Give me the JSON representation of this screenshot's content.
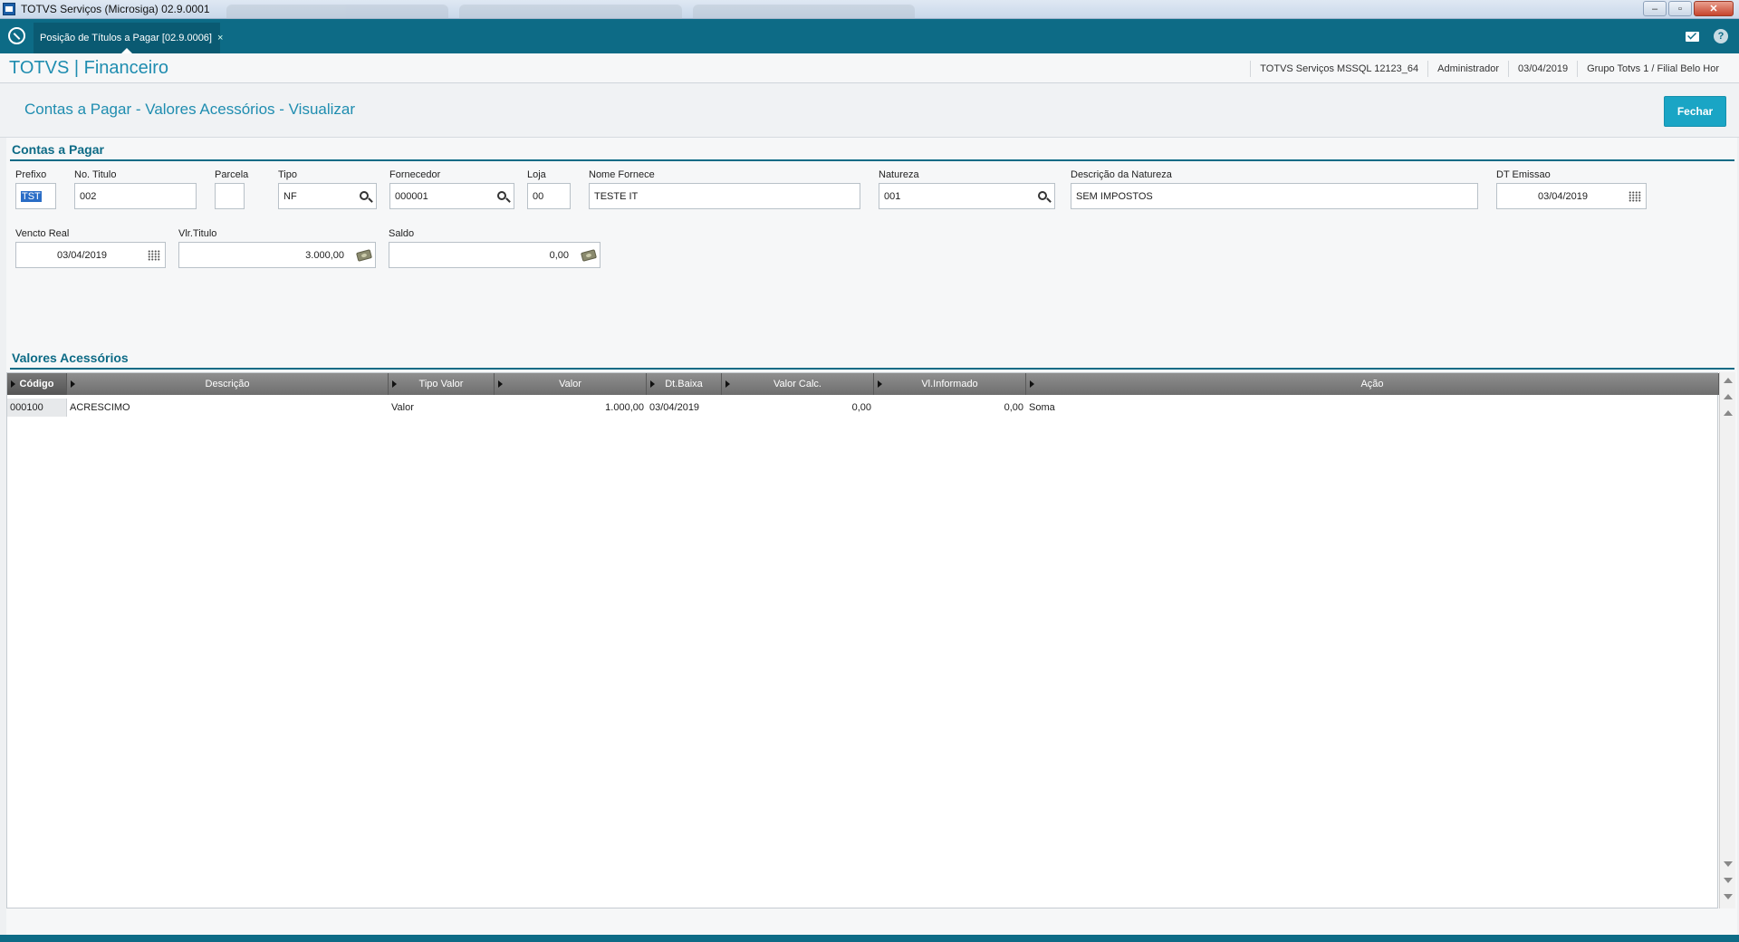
{
  "window": {
    "title": "TOTVS Serviços (Microsiga) 02.9.0001",
    "minimize": "–",
    "restore": "▫",
    "close": "✕"
  },
  "tabbar": {
    "tab_label": "Posição de Títulos a Pagar [02.9.0006]",
    "tab_close": "×",
    "help": "?"
  },
  "header": {
    "brand": "TOTVS | Financeiro",
    "server": "TOTVS Serviços MSSQL 12123_64",
    "user": "Administrador",
    "date": "03/04/2019",
    "company": "Grupo Totvs 1 / Filial Belo Hor"
  },
  "page": {
    "title": "Contas a Pagar - Valores Acessórios - Visualizar",
    "close_button": "Fechar"
  },
  "contas": {
    "section_title": "Contas a Pagar",
    "fields": {
      "prefixo": {
        "label": "Prefixo",
        "value": "TST"
      },
      "no_titulo": {
        "label": "No. Titulo",
        "value": "002"
      },
      "parcela": {
        "label": "Parcela",
        "value": ""
      },
      "tipo": {
        "label": "Tipo",
        "value": "NF"
      },
      "fornecedor": {
        "label": "Fornecedor",
        "value": "000001"
      },
      "loja": {
        "label": "Loja",
        "value": "00"
      },
      "nome_fornece": {
        "label": "Nome Fornece",
        "value": "TESTE IT"
      },
      "natureza": {
        "label": "Natureza",
        "value": "001"
      },
      "desc_natureza": {
        "label": "Descrição da Natureza",
        "value": "SEM IMPOSTOS"
      },
      "dt_emissao": {
        "label": "DT Emissao",
        "value": "03/04/2019"
      },
      "vencto_real": {
        "label": "Vencto Real",
        "value": "03/04/2019"
      },
      "vlr_titulo": {
        "label": "Vlr.Titulo",
        "value": "3.000,00"
      },
      "saldo": {
        "label": "Saldo",
        "value": "0,00"
      }
    }
  },
  "acessorios": {
    "section_title": "Valores Acessórios",
    "columns": [
      "Código",
      "Descrição",
      "Tipo Valor",
      "Valor",
      "Dt.Baixa",
      "Valor Calc.",
      "Vl.Informado",
      "Ação"
    ],
    "rows": [
      {
        "codigo": "000100",
        "descricao": "ACRESCIMO",
        "tipo_valor": "Valor",
        "valor": "1.000,00",
        "dt_baixa": "03/04/2019",
        "valor_calc": "0,00",
        "vl_informado": "0,00",
        "acao": "Soma"
      }
    ]
  },
  "icons": {
    "search": "search-icon",
    "calendar": "calendar-icon",
    "money": "money-icon",
    "mail": "mail-icon",
    "help": "help-icon",
    "home": "home-icon"
  },
  "colors": {
    "teal": "#0d6b86",
    "accent": "#1f8db0",
    "button": "#1aa5c5"
  }
}
